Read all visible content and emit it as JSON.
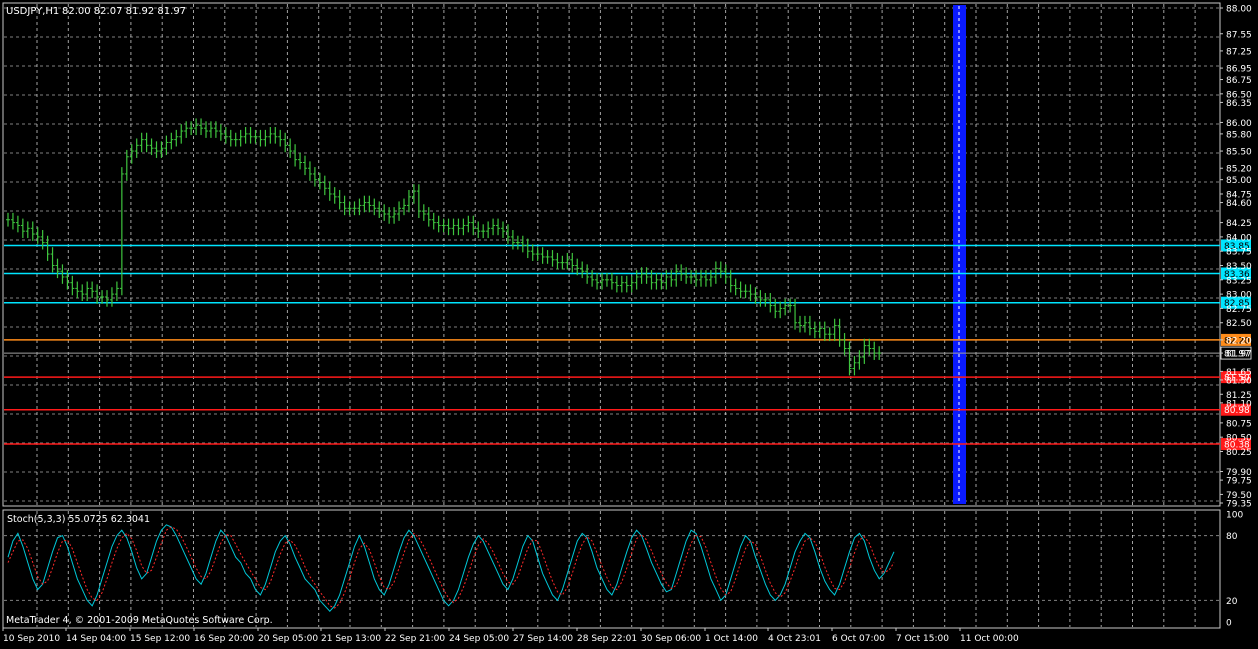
{
  "chart_data": [
    {
      "type": "candlestick",
      "title": "USDJPY,H1",
      "ohlc_header": "82.00 82.07 81.92 81.97",
      "current_price": "81.97",
      "ylim": [
        79.35,
        88.0
      ],
      "y_ticks": [
        "88.00",
        "87.55",
        "87.25",
        "86.95",
        "86.75",
        "86.50",
        "86.35",
        "86.00",
        "85.80",
        "85.50",
        "85.20",
        "85.00",
        "84.75",
        "84.60",
        "84.25",
        "84.00",
        "83.75",
        "83.50",
        "83.25",
        "83.00",
        "82.75",
        "82.50",
        "82.20",
        "81.97",
        "81.65",
        "81.50",
        "81.25",
        "81.10",
        "80.75",
        "80.50",
        "80.25",
        "79.90",
        "79.75",
        "79.50",
        "79.35"
      ],
      "x_tick_labels": [
        "10 Sep 2010",
        "14 Sep 04:00",
        "15 Sep 12:00",
        "16 Sep 20:00",
        "20 Sep 05:00",
        "21 Sep 13:00",
        "22 Sep 21:00",
        "24 Sep 05:00",
        "27 Sep 14:00",
        "28 Sep 22:01",
        "30 Sep 06:00",
        "1 Oct 14:00",
        "4 Oct 23:01",
        "6 Oct 07:00",
        "7 Oct 15:00",
        "11 Oct 00:00"
      ],
      "x": [
        0,
        5,
        10,
        15,
        20,
        25,
        30,
        35,
        40,
        45,
        50,
        55,
        60,
        65,
        70,
        75,
        80,
        85,
        90,
        95,
        100,
        105,
        110,
        115,
        120,
        125,
        130,
        135,
        140,
        145,
        150,
        155,
        160,
        165,
        170,
        175,
        180,
        185,
        190,
        195,
        200,
        205,
        210,
        215,
        220,
        225,
        230,
        235,
        240,
        245,
        250,
        255,
        260,
        265,
        270,
        275,
        280,
        285,
        290,
        295,
        300,
        305,
        310,
        315,
        320,
        325,
        330,
        335,
        340,
        345,
        350,
        355,
        360,
        365,
        370,
        375,
        380,
        385,
        390,
        395,
        400,
        405,
        410,
        415,
        420,
        425,
        430,
        435,
        440,
        445,
        450,
        455,
        460,
        465,
        470,
        475,
        480,
        485,
        490,
        495,
        500,
        505,
        510,
        515,
        520,
        525,
        530,
        535,
        540,
        545,
        550,
        555,
        560,
        565,
        570,
        575,
        580,
        585,
        590,
        595,
        600,
        605,
        610,
        615,
        620,
        625,
        630,
        635,
        640,
        645,
        650,
        655,
        660,
        665,
        670,
        675,
        680,
        685,
        690,
        695,
        700,
        705,
        710,
        715,
        720,
        725,
        730,
        735,
        740,
        745,
        750,
        755,
        760,
        765,
        770,
        775,
        780,
        785,
        790,
        795,
        800,
        805,
        810,
        815,
        820,
        825,
        830,
        835,
        840,
        845,
        850,
        855,
        860,
        865,
        870,
        875,
        880,
        885,
        890,
        895,
        900,
        905,
        910,
        915,
        920,
        925,
        930,
        935,
        940,
        945,
        950,
        955,
        960,
        965,
        970,
        975
      ],
      "close_series": [
        84.3,
        84.25,
        84.2,
        84.1,
        84.15,
        84.05,
        84.0,
        83.9,
        83.7,
        83.5,
        83.4,
        83.3,
        83.2,
        83.1,
        83.05,
        83.0,
        83.1,
        83.05,
        82.95,
        82.95,
        82.9,
        83.0,
        83.1,
        85.1,
        85.4,
        85.5,
        85.6,
        85.7,
        85.6,
        85.55,
        85.5,
        85.55,
        85.65,
        85.7,
        85.75,
        85.85,
        85.9,
        85.9,
        85.95,
        85.9,
        85.85,
        85.9,
        85.85,
        85.8,
        85.75,
        85.7,
        85.7,
        85.75,
        85.8,
        85.75,
        85.75,
        85.7,
        85.75,
        85.8,
        85.75,
        85.7,
        85.6,
        85.5,
        85.35,
        85.3,
        85.2,
        85.1,
        85.0,
        84.95,
        84.85,
        84.75,
        84.7,
        84.6,
        84.5,
        84.5,
        84.5,
        84.55,
        84.6,
        84.55,
        84.5,
        84.45,
        84.4,
        84.35,
        84.4,
        84.5,
        84.55,
        84.7,
        84.8,
        84.45,
        84.4,
        84.3,
        84.25,
        84.2,
        84.2,
        84.15,
        84.2,
        84.15,
        84.2,
        84.25,
        84.15,
        84.1,
        84.1,
        84.15,
        84.2,
        84.15,
        84.1,
        84.0,
        83.9,
        83.9,
        83.85,
        83.75,
        83.7,
        83.7,
        83.65,
        83.65,
        83.6,
        83.55,
        83.55,
        83.6,
        83.5,
        83.45,
        83.4,
        83.3,
        83.25,
        83.2,
        83.25,
        83.25,
        83.2,
        83.15,
        83.2,
        83.15,
        83.2,
        83.3,
        83.35,
        83.3,
        83.2,
        83.25,
        83.2,
        83.3,
        83.25,
        83.4,
        83.35,
        83.3,
        83.3,
        83.25,
        83.3,
        83.25,
        83.3,
        83.45,
        83.4,
        83.3,
        83.15,
        83.1,
        83.05,
        83.05,
        83.0,
        82.95,
        82.9,
        82.9,
        82.8,
        82.7,
        82.75,
        82.8,
        82.8,
        82.5,
        82.45,
        82.5,
        82.4,
        82.35,
        82.4,
        82.3,
        82.3,
        82.45,
        82.2,
        82.05,
        81.7,
        81.8,
        81.9,
        82.1,
        82.05,
        81.97,
        81.97
      ],
      "horizontal_levels": [
        {
          "price": 83.85,
          "label": "83.85",
          "color": "#00e5ff"
        },
        {
          "price": 83.36,
          "label": "83.36",
          "color": "#00e5ff"
        },
        {
          "price": 82.85,
          "label": "82.85",
          "color": "#00e5ff"
        },
        {
          "price": 82.2,
          "label": "82.20",
          "color": "#ff8c1a"
        },
        {
          "price": 81.55,
          "label": "81.50",
          "color": "#ff1a1a"
        },
        {
          "price": 80.98,
          "label": "80.98",
          "color": "#ff1a1a"
        },
        {
          "price": 80.38,
          "label": "80.38",
          "color": "#ff1a1a"
        }
      ]
    },
    {
      "type": "line",
      "title": "Stoch(5,3,3) 55.0725 62.3041",
      "ylim": [
        0,
        100
      ],
      "y_ticks": [
        "100",
        "80",
        "20",
        "0"
      ],
      "series": [
        {
          "name": "main",
          "color": "#00c8d8",
          "values": [
            60,
            75,
            82,
            70,
            55,
            40,
            30,
            35,
            50,
            65,
            78,
            80,
            70,
            55,
            40,
            30,
            20,
            15,
            25,
            40,
            55,
            70,
            80,
            85,
            78,
            65,
            50,
            40,
            45,
            60,
            75,
            85,
            90,
            88,
            80,
            70,
            60,
            50,
            40,
            35,
            45,
            60,
            75,
            85,
            80,
            70,
            60,
            55,
            45,
            40,
            30,
            25,
            35,
            50,
            65,
            75,
            80,
            72,
            60,
            50,
            40,
            35,
            30,
            20,
            15,
            10,
            15,
            25,
            40,
            55,
            70,
            80,
            70,
            55,
            40,
            30,
            25,
            35,
            50,
            65,
            78,
            85,
            80,
            70,
            60,
            50,
            40,
            30,
            20,
            15,
            20,
            30,
            45,
            60,
            72,
            80,
            75,
            65,
            55,
            45,
            35,
            30,
            40,
            55,
            70,
            80,
            75,
            60,
            45,
            35,
            25,
            20,
            30,
            45,
            60,
            75,
            82,
            78,
            65,
            50,
            40,
            30,
            25,
            35,
            50,
            65,
            78,
            85,
            80,
            68,
            55,
            45,
            35,
            28,
            30,
            45,
            60,
            75,
            85,
            82,
            70,
            55,
            40,
            30,
            20,
            25,
            40,
            55,
            70,
            80,
            75,
            60,
            48,
            35,
            25,
            20,
            25,
            35,
            50,
            65,
            75,
            82,
            78,
            65,
            50,
            38,
            30,
            25,
            35,
            50,
            65,
            78,
            82,
            75,
            60,
            48,
            40,
            45,
            55,
            65
          ]
        },
        {
          "name": "signal",
          "color": "#ff2a2a",
          "values": [
            55,
            65,
            75,
            76,
            68,
            55,
            42,
            35,
            38,
            50,
            64,
            75,
            76,
            68,
            55,
            42,
            30,
            22,
            20,
            27,
            40,
            55,
            68,
            78,
            82,
            77,
            66,
            52,
            45,
            48,
            60,
            73,
            85,
            88,
            86,
            79,
            70,
            60,
            50,
            42,
            40,
            47,
            60,
            73,
            81,
            80,
            72,
            63,
            55,
            47,
            40,
            32,
            30,
            37,
            50,
            63,
            73,
            76,
            71,
            62,
            51,
            42,
            35,
            28,
            22,
            15,
            13,
            17,
            27,
            40,
            55,
            68,
            73,
            67,
            55,
            42,
            32,
            30,
            37,
            50,
            64,
            76,
            82,
            78,
            70,
            60,
            50,
            40,
            30,
            22,
            18,
            22,
            32,
            45,
            59,
            71,
            77,
            73,
            65,
            55,
            45,
            37,
            35,
            42,
            55,
            68,
            76,
            75,
            63,
            50,
            38,
            28,
            25,
            32,
            45,
            60,
            72,
            79,
            75,
            64,
            52,
            41,
            32,
            30,
            37,
            50,
            64,
            77,
            81,
            76,
            66,
            55,
            45,
            36,
            31,
            34,
            45,
            60,
            73,
            80,
            79,
            69,
            55,
            42,
            31,
            25,
            28,
            40,
            55,
            68,
            75,
            72,
            61,
            48,
            36,
            27,
            23,
            27,
            38,
            50,
            64,
            75,
            78,
            74,
            64,
            51,
            40,
            31,
            30,
            37,
            50,
            64,
            76,
            79,
            73,
            61,
            51,
            46,
            48,
            55
          ]
        }
      ],
      "copyright": "MetaTrader 4, © 2001-2009 MetaQuotes Software Corp."
    }
  ],
  "colors": {
    "background": "#000000",
    "grid": "#d8d8d8",
    "frame": "#c8c8c8",
    "bars": "#3ec43e",
    "highlight_column": "#0a1aff"
  }
}
